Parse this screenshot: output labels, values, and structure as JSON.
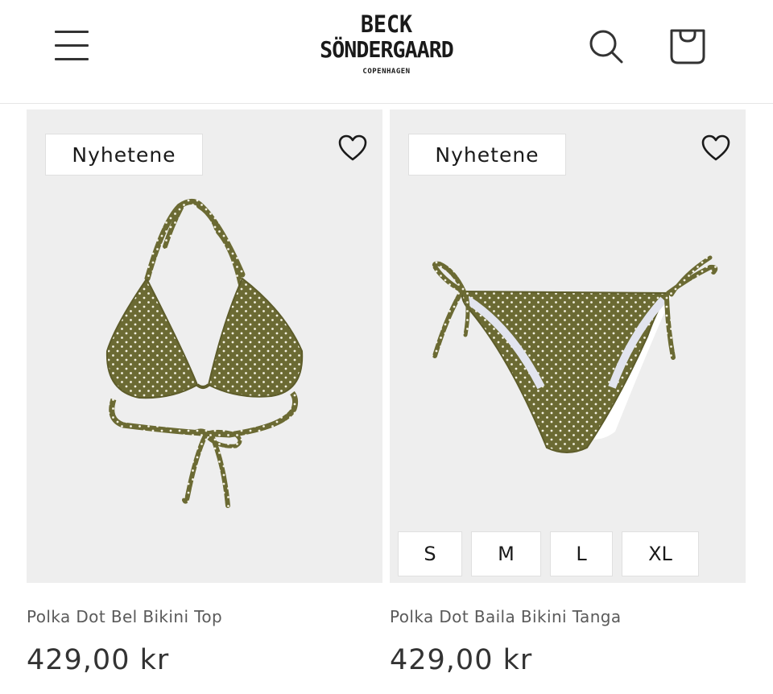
{
  "header": {
    "logo_line1": "BECK",
    "logo_line2": "SÖNDERGAARD",
    "logo_line3": "COPENHAGEN",
    "icons": [
      "menu-icon",
      "search-icon",
      "shopping-bag-icon"
    ]
  },
  "products": [
    {
      "badge": "Nyhetene",
      "title": "Polka Dot Bel Bikini Top",
      "price": "429,00 kr",
      "sizes": []
    },
    {
      "badge": "Nyhetene",
      "title": "Polka Dot Baila Bikini Tanga",
      "price": "429,00 kr",
      "sizes": [
        "S",
        "M",
        "L",
        "XL"
      ]
    }
  ],
  "colors": {
    "fabric": "#6b6a33",
    "card_background": "#eeeeee",
    "lining": "#ffffff"
  }
}
